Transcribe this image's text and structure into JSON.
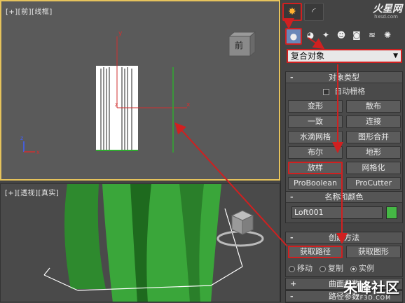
{
  "viewports": {
    "front_label": "[+][前][线框]",
    "persp_label": "[+][透视][真实]",
    "viewcube_front_text": "前"
  },
  "panel": {
    "logo": "火星网",
    "logo_sub": "hxsd.com",
    "object_type_dropdown": "复合对象",
    "object_type_title": "对象类型",
    "autogrid_label": "自动栅格",
    "buttons": [
      "变形",
      "散布",
      "一致",
      "连接",
      "水滴网格",
      "图形合并",
      "布尔",
      "地形",
      "放样",
      "网格化",
      "ProBoolean",
      "ProCutter"
    ],
    "name_color_title": "名称和颜色",
    "name_value": "Loft001",
    "creation_title": "创建方法",
    "get_path": "获取路径",
    "get_shape": "获取图形",
    "radio_move": "移动",
    "radio_copy": "复制",
    "radio_instance": "实例",
    "surface_title": "曲面参数",
    "path_title": "路径参数"
  },
  "watermark": {
    "text": "朱峰社区",
    "sub": "ZF3D.COM"
  },
  "colors": {
    "highlight": "#d02020",
    "active_viewport": "#e6c35c",
    "object_color": "#45b845"
  }
}
